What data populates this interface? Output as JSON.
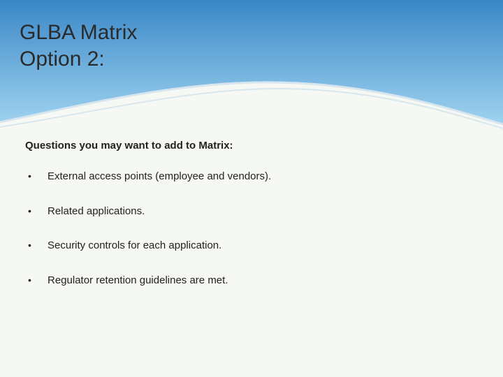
{
  "title_line1": "GLBA Matrix",
  "title_line2": "Option 2:",
  "subhead": "Questions you may want to add to Matrix:",
  "bullets": [
    "External access points (employee and vendors).",
    "Related applications.",
    "Security controls for each application.",
    "Regulator retention guidelines are met."
  ]
}
